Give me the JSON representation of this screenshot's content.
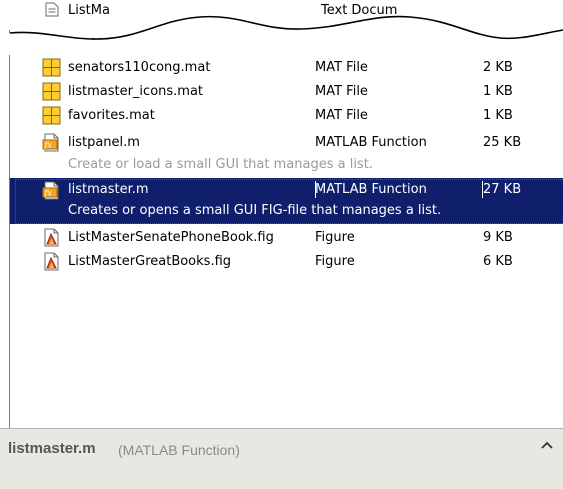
{
  "files": [
    {
      "name": "ListMaster - GreatBooks.txt",
      "type": "Text Document",
      "size": "",
      "icon": "text-document-icon"
    },
    {
      "name": "senators110cong.mat",
      "type": "MAT File",
      "size": "2 KB",
      "icon": "mat-file-icon"
    },
    {
      "name": "listmaster_icons.mat",
      "type": "MAT File",
      "size": "1 KB",
      "icon": "mat-file-icon"
    },
    {
      "name": "favorites.mat",
      "type": "MAT File",
      "size": "1 KB",
      "icon": "mat-file-icon"
    },
    {
      "name": "listpanel.m",
      "type": "MATLAB Function",
      "size": "25 KB",
      "icon": "matlab-function-icon",
      "description": "Create or load a small GUI that manages a list."
    },
    {
      "name": "listmaster.m",
      "type": "MATLAB Function",
      "size": "27 KB",
      "icon": "matlab-function-icon",
      "description": "Creates or opens a small GUI FIG-file that manages a list.",
      "selected": true
    },
    {
      "name": "ListMasterSenatePhoneBook.fig",
      "type": "Figure",
      "size": "9 KB",
      "icon": "figure-icon"
    },
    {
      "name": "ListMasterGreatBooks.fig",
      "type": "Figure",
      "size": "6 KB",
      "icon": "figure-icon"
    }
  ],
  "torn_top": {
    "name": "ListMa",
    "type": "Text Docum"
  },
  "first_row_visible_name": "ListMaster - G",
  "status": {
    "name": "listmaster.m",
    "type": "(MATLAB Function)",
    "collapse_icon": "chevron-up-icon"
  },
  "colors": {
    "selection": "#0f1f6b",
    "description": "#9a9a9a",
    "status_bg": "#e9e7e2"
  }
}
